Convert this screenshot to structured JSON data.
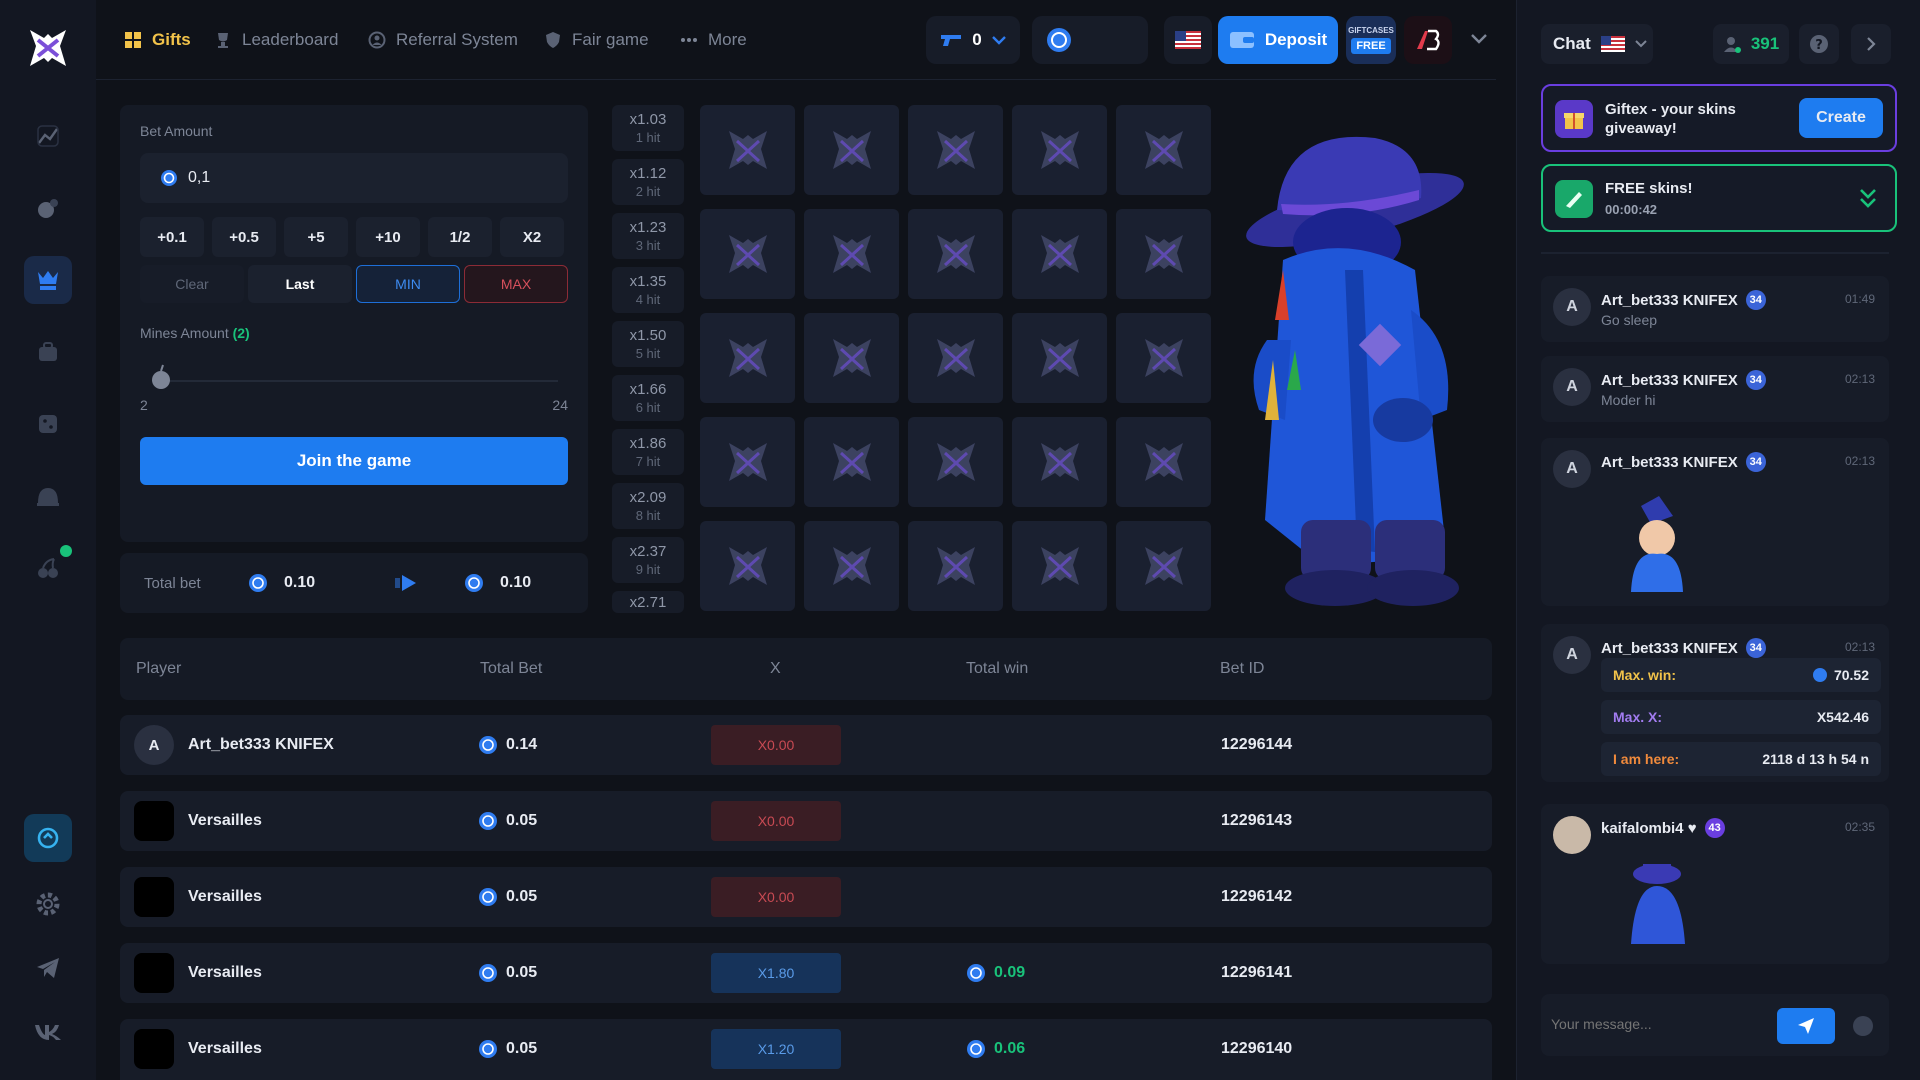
{
  "nav": {
    "items": [
      {
        "label": "Gifts",
        "active": true
      },
      {
        "label": "Leaderboard"
      },
      {
        "label": "Referral System"
      },
      {
        "label": "Fair game"
      },
      {
        "label": "More"
      }
    ],
    "balance_count": "0",
    "deposit_label": "Deposit",
    "giftcases_top": "GIFTCASES",
    "giftcases_bottom": "FREE"
  },
  "bet": {
    "amount_label": "Bet Amount",
    "amount_value": "0,1",
    "chips": [
      "+0.1",
      "+0.5",
      "+5",
      "+10",
      "1/2",
      "X2"
    ],
    "clear": "Clear",
    "last": "Last",
    "min": "MIN",
    "max": "MAX",
    "mines_label": "Mines Amount",
    "mines_value": "(2)",
    "mines_level": 2,
    "slider_min": "2",
    "slider_max": "24",
    "join": "Join the game",
    "total_label": "Total bet",
    "total_left": "0.10",
    "total_right": "0.10"
  },
  "multipliers": [
    {
      "x": "x1.03",
      "hit": "1 hit"
    },
    {
      "x": "x1.12",
      "hit": "2 hit"
    },
    {
      "x": "x1.23",
      "hit": "3 hit"
    },
    {
      "x": "x1.35",
      "hit": "4 hit"
    },
    {
      "x": "x1.50",
      "hit": "5 hit"
    },
    {
      "x": "x1.66",
      "hit": "6 hit"
    },
    {
      "x": "x1.86",
      "hit": "7 hit"
    },
    {
      "x": "x2.09",
      "hit": "8 hit"
    },
    {
      "x": "x2.37",
      "hit": "9 hit"
    },
    {
      "x": "x2.71",
      "hit": ""
    }
  ],
  "table": {
    "headers": [
      "Player",
      "Total Bet",
      "X",
      "Total win",
      "Bet ID"
    ],
    "rows": [
      {
        "player": "Art_bet333 KNIFEX",
        "bet": "0.14",
        "x": "X0.00",
        "win": "",
        "id": "12296144",
        "result": "lose"
      },
      {
        "player": "Versailles",
        "bet": "0.05",
        "x": "X0.00",
        "win": "",
        "id": "12296143",
        "result": "lose"
      },
      {
        "player": "Versailles",
        "bet": "0.05",
        "x": "X0.00",
        "win": "",
        "id": "12296142",
        "result": "lose"
      },
      {
        "player": "Versailles",
        "bet": "0.05",
        "x": "X1.80",
        "win": "0.09",
        "id": "12296141",
        "result": "win"
      },
      {
        "player": "Versailles",
        "bet": "0.05",
        "x": "X1.20",
        "win": "0.06",
        "id": "12296140",
        "result": "win"
      }
    ]
  },
  "chat": {
    "title": "Chat",
    "online": "391",
    "giveaway_text": "Giftex - your skins giveaway!",
    "create": "Create",
    "free_title": "FREE skins!",
    "free_timer": "00:00:42",
    "messages": [
      {
        "name": "Art_bet333 KNIFEX",
        "level": "34",
        "time": "01:49",
        "text": "Go sleep"
      },
      {
        "name": "Art_bet333 KNIFEX",
        "level": "34",
        "time": "02:13",
        "text": "Moder hi"
      },
      {
        "name": "Art_bet333 KNIFEX",
        "level": "34",
        "time": "02:13",
        "text": ""
      },
      {
        "name": "Art_bet333 KNIFEX",
        "level": "34",
        "time": "02:13",
        "text": ""
      },
      {
        "name": "kaifalombi4 ♥",
        "level": "43",
        "time": "02:35",
        "text": ""
      }
    ],
    "stats": {
      "max_win_label": "Max. win:",
      "max_win": "70.52",
      "max_x_label": "Max. X:",
      "max_x": "X542.46",
      "here_label": "I am here:",
      "here": "2118 d 13 h 54 n"
    },
    "placeholder": "Your message..."
  },
  "colors": {
    "accent": "#1e7cf0",
    "gold": "#f2c34a",
    "green": "#19c27a",
    "lose": "#c84a53"
  }
}
